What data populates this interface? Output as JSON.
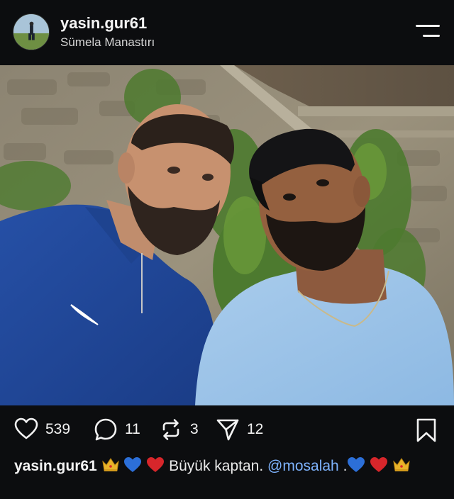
{
  "post": {
    "username": "yasin.gur61",
    "location": "Sümela Manastırı"
  },
  "actions": {
    "likes": "539",
    "comments": "11",
    "reposts": "3",
    "shares": "12"
  },
  "caption": {
    "username": "yasin.gur61",
    "text": "Büyük kaptan.",
    "mention": "@mosalah",
    "separator": "."
  },
  "colors": {
    "background": "#0c0d0f",
    "mention": "#7fb4ff",
    "heart_red": "#d7262b",
    "heart_blue": "#2c6fd8",
    "crown": "#e8b32a"
  },
  "icons": {
    "menu": "menu-icon",
    "like": "heart-outline-icon",
    "comment": "speech-bubble-icon",
    "repost": "repost-arrows-icon",
    "share": "paper-plane-icon",
    "save": "bookmark-icon"
  }
}
